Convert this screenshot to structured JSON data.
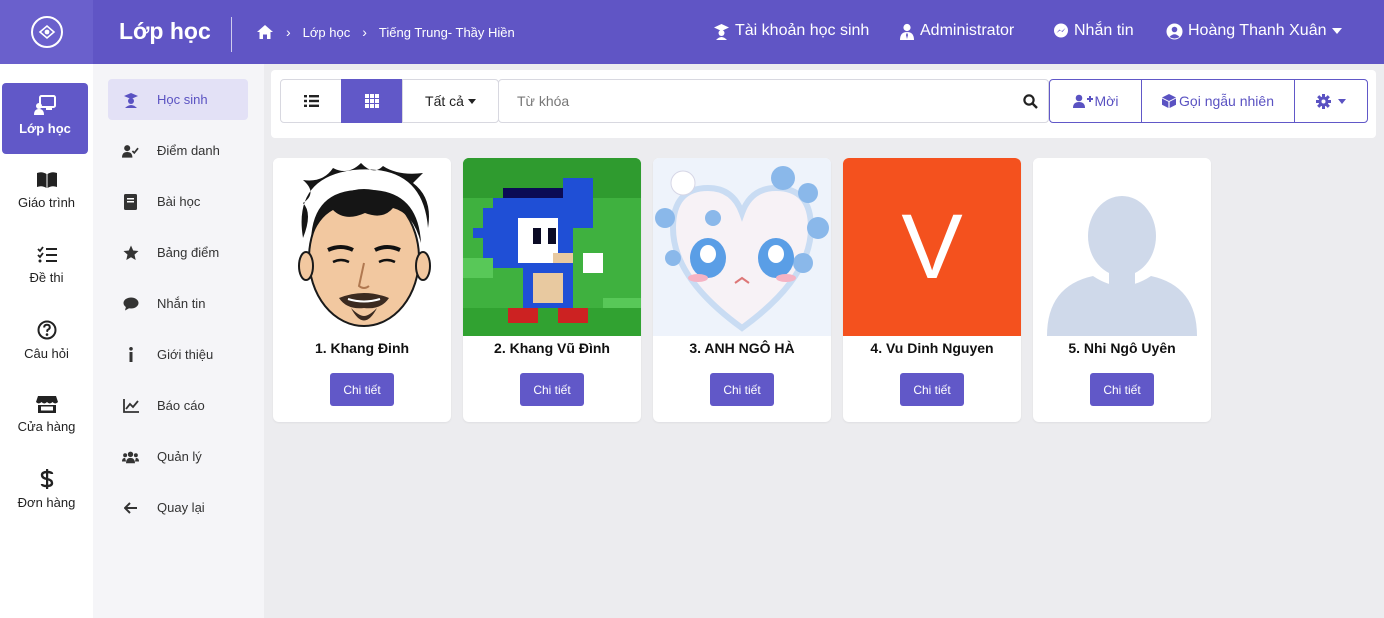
{
  "app": {
    "title": "Lớp học"
  },
  "breadcrumb": [
    "Lớp học",
    "Tiếng Trung- Thầy Hiền"
  ],
  "topnav": {
    "student_accounts": "Tài khoản học sinh",
    "admin": "Administrator",
    "messages": "Nhắn tin",
    "user": "Hoàng Thanh Xuân"
  },
  "rail": [
    {
      "label": "Lớp học",
      "icon": "classroom-icon"
    },
    {
      "label": "Giáo trình",
      "icon": "book-open-icon"
    },
    {
      "label": "Đề thi",
      "icon": "checklist-icon"
    },
    {
      "label": "Câu hỏi",
      "icon": "question-icon"
    },
    {
      "label": "Cửa hàng",
      "icon": "store-icon"
    },
    {
      "label": "Đơn hàng",
      "icon": "dollar-icon"
    }
  ],
  "submenu": [
    {
      "label": "Học sinh",
      "icon": "graduate-icon"
    },
    {
      "label": "Điểm danh",
      "icon": "user-check-icon"
    },
    {
      "label": "Bài học",
      "icon": "book-icon"
    },
    {
      "label": "Bảng điểm",
      "icon": "star-icon"
    },
    {
      "label": "Nhắn tin",
      "icon": "chat-icon"
    },
    {
      "label": "Giới thiệu",
      "icon": "info-icon"
    },
    {
      "label": "Báo cáo",
      "icon": "chart-icon"
    },
    {
      "label": "Quản lý",
      "icon": "users-icon"
    },
    {
      "label": "Quay lại",
      "icon": "arrow-left-icon"
    }
  ],
  "toolbar": {
    "filter_label": "Tất cả",
    "search_placeholder": "Từ khóa",
    "invite_label": "Mời",
    "random_label": "Gọi ngẫu nhiên"
  },
  "students": [
    {
      "name": "1. Khang Đinh",
      "detail": "Chi tiết"
    },
    {
      "name": "2. Khang Vũ Đình",
      "detail": "Chi tiết"
    },
    {
      "name": "3. ANH NGÔ HÀ",
      "detail": "Chi tiết"
    },
    {
      "name": "4. Vu Dinh Nguyen",
      "detail": "Chi tiết",
      "avatar_letter": "V"
    },
    {
      "name": "5. Nhi Ngô Uyên",
      "detail": "Chi tiết"
    }
  ],
  "colors": {
    "primary": "#6158c8",
    "topbar": "#6055c5",
    "avatar_orange": "#f4511e"
  }
}
